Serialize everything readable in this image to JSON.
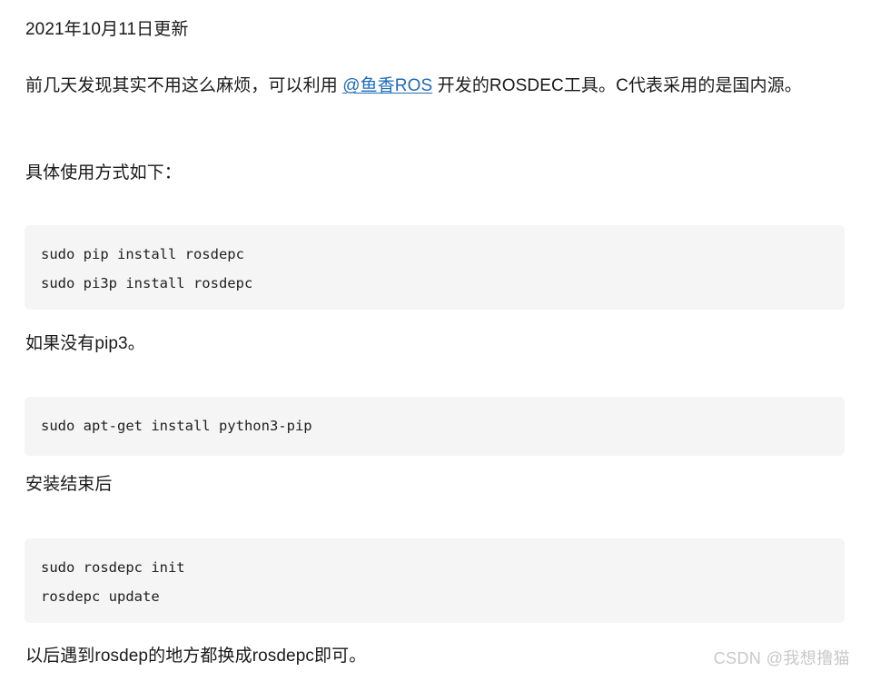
{
  "article": {
    "date_heading": "2021年10月11日更新",
    "intro": {
      "before_link": "前几天发现其实不用这么麻烦，可以利用 ",
      "link_text": "@鱼香ROS",
      "after_link": " 开发的ROSDEC工具。C代表采用的是国内源。",
      "link_color": "#1e6bb8"
    },
    "usage_label": "具体使用方式如下：",
    "no_pip3_label": "如果没有pip3。",
    "after_install_label": "安装结束后",
    "closing_note": "以后遇到rosdep的地方都换成rosdepc即可。"
  },
  "code_blocks": [
    {
      "name": "install-rosdepc",
      "lines": [
        "sudo pip install rosdepc",
        "sudo pi3p install rosdepc"
      ]
    },
    {
      "name": "install-python3-pip",
      "lines": [
        "sudo apt-get install python3-pip"
      ]
    },
    {
      "name": "rosdepc-init-update",
      "lines": [
        "sudo rosdepc init",
        "rosdepc update"
      ]
    }
  ],
  "watermark": {
    "text": "CSDN @我想撸猫",
    "color": "#c8c8c8"
  },
  "theme": {
    "background": "#ffffff",
    "text_color": "#1a1a1a",
    "code_background": "#f5f5f5",
    "code_text_color": "#1f1f1f"
  }
}
